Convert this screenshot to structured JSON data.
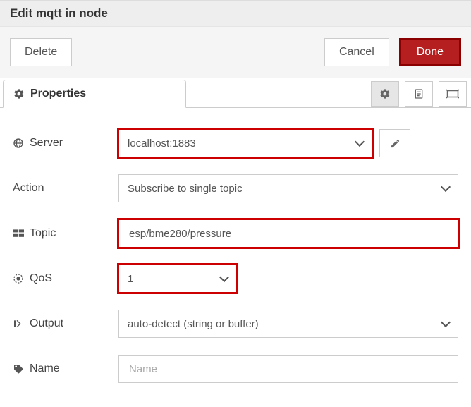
{
  "title": "Edit mqtt in node",
  "buttons": {
    "delete": "Delete",
    "cancel": "Cancel",
    "done": "Done"
  },
  "tabs": {
    "properties": "Properties"
  },
  "form": {
    "server": {
      "label": "Server",
      "value": "localhost:1883"
    },
    "action": {
      "label": "Action",
      "value": "Subscribe to single topic"
    },
    "topic": {
      "label": "Topic",
      "value": "esp/bme280/pressure"
    },
    "qos": {
      "label": "QoS",
      "value": "1"
    },
    "output": {
      "label": "Output",
      "value": "auto-detect (string or buffer)"
    },
    "name": {
      "label": "Name",
      "value": "",
      "placeholder": "Name"
    }
  }
}
